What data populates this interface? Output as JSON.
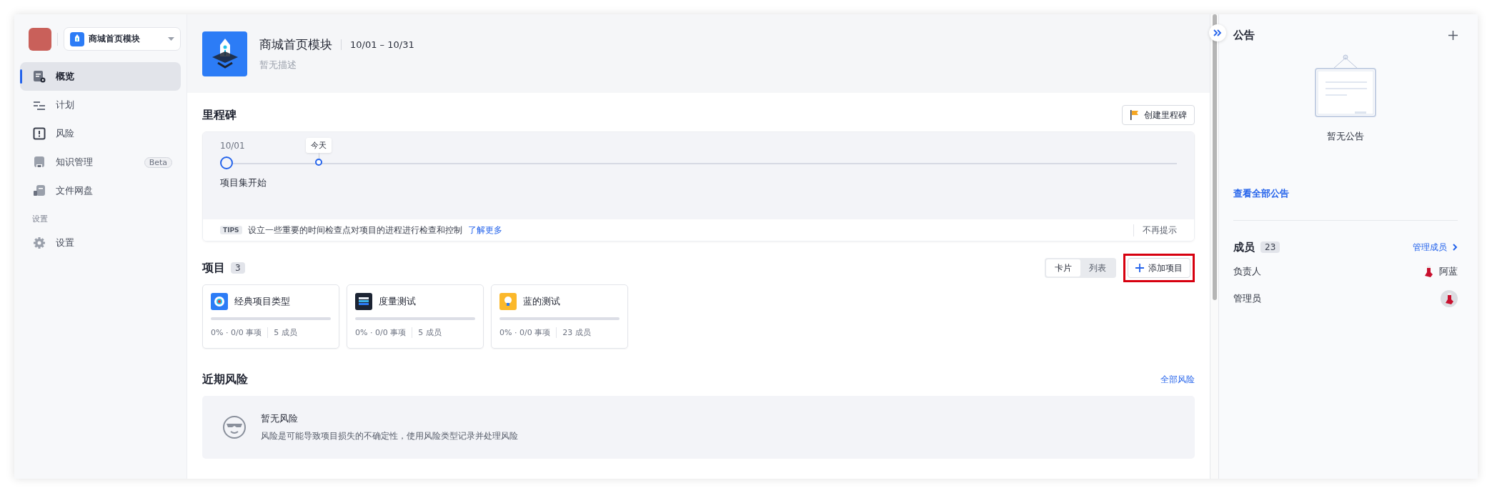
{
  "sidebar": {
    "project_select": {
      "value": "商城首页模块"
    },
    "items": [
      {
        "kind": "overview",
        "label": "概览",
        "selected": true
      },
      {
        "kind": "plan",
        "label": "计划",
        "selected": false
      },
      {
        "kind": "risk",
        "label": "风险",
        "selected": false
      },
      {
        "kind": "knowledge",
        "label": "知识管理",
        "selected": false,
        "badge": "Beta"
      },
      {
        "kind": "files",
        "label": "文件网盘",
        "selected": false
      }
    ],
    "section_title": "设置",
    "settings_items": [
      {
        "kind": "settings",
        "label": "设置",
        "selected": false
      }
    ]
  },
  "header": {
    "title": "商城首页模块",
    "date_range": "10/01 – 10/31",
    "description": "暂无描述"
  },
  "milestones": {
    "title": "里程碑",
    "create_button": "创建里程碑",
    "start_date": "10/01",
    "today_label": "今天",
    "start_label": "项目集开始",
    "tips_badge": "TIPS",
    "tips_text": "设立一些重要的时间检查点对项目的进程进行检查和控制",
    "tips_link": "了解更多",
    "dismiss": "不再提示"
  },
  "projects": {
    "title": "项目",
    "count": "3",
    "view_tabs": [
      {
        "label": "卡片",
        "selected": true
      },
      {
        "label": "列表",
        "selected": false
      }
    ],
    "add_button": {
      "label": "添加项目",
      "highlighted": true
    },
    "cards": [
      {
        "kind": "target",
        "name": "经典项目类型",
        "level": 0,
        "stats": "0% · 0/0 事项",
        "members": "5 成员"
      },
      {
        "kind": "stack",
        "name": "度量测试",
        "level": 0,
        "stats": "0% · 0/0 事项",
        "members": "5 成员"
      },
      {
        "kind": "bulb",
        "name": "蓝的测试",
        "level": 0,
        "stats": "0% · 0/0 事项",
        "members": "23 成员"
      }
    ]
  },
  "risks": {
    "title": "近期风险",
    "link": "全部风险",
    "empty_title": "暂无风险",
    "empty_text": "风险是可能导致项目损失的不确定性，使用风险类型记录并处理风险"
  },
  "announcements": {
    "title": "公告",
    "empty": "暂无公告",
    "link": "查看全部公告"
  },
  "members": {
    "title": "成员",
    "count": "23",
    "manage_link": "管理成员",
    "rows": [
      {
        "role": "负责人",
        "name": "阿蓝"
      },
      {
        "role": "管理员"
      }
    ]
  }
}
